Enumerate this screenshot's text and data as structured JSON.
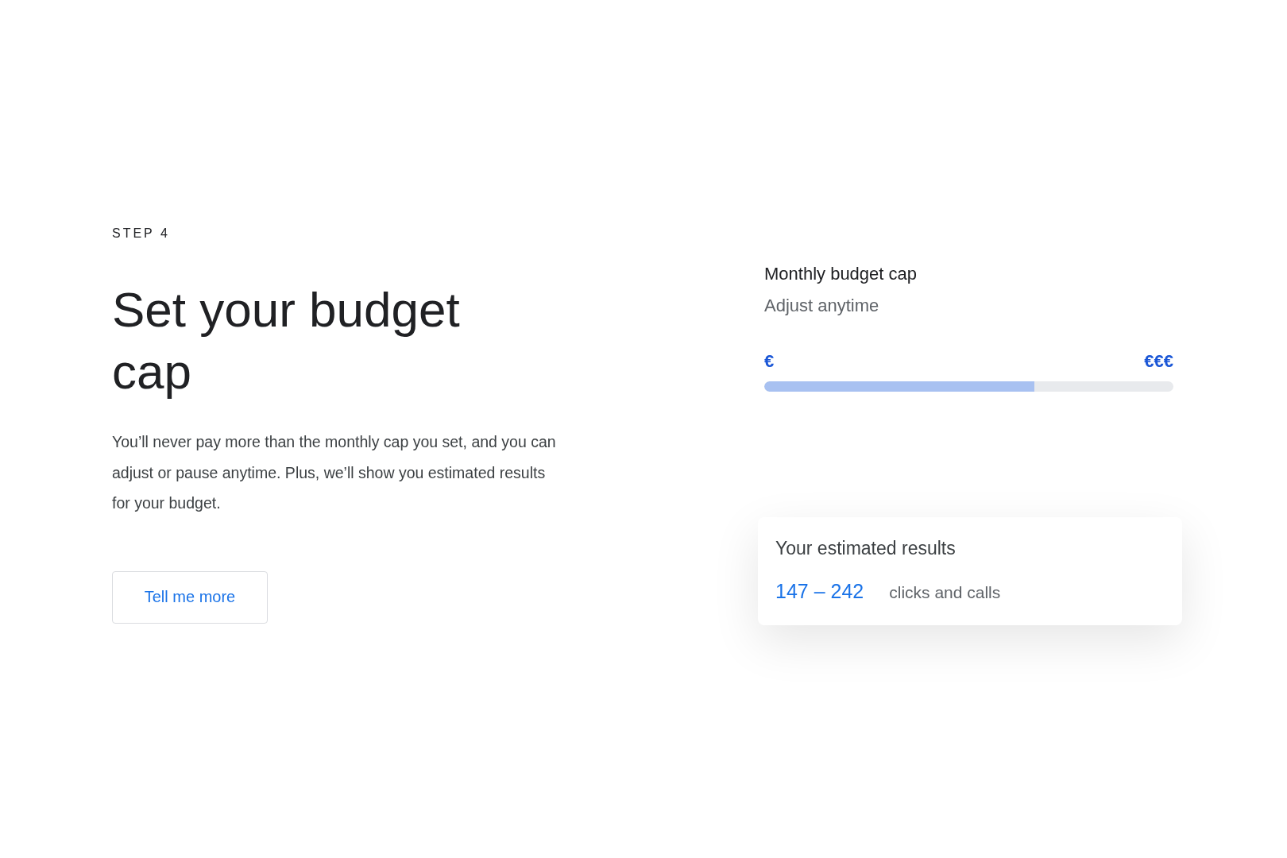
{
  "step_label": "STEP 4",
  "heading": "Set your budget cap",
  "description": "You’ll never pay more than the monthly cap you set, and you can adjust or pause anytime. Plus, we’ll show you estimated results for your budget.",
  "button": {
    "label": "Tell me more"
  },
  "budget": {
    "title": "Monthly budget cap",
    "subtitle": "Adjust anytime",
    "min_label": "€",
    "max_label": "€€€",
    "level": 0.66
  },
  "results": {
    "title": "Your estimated results",
    "range": "147 – 242",
    "unit": "clicks and calls"
  }
}
